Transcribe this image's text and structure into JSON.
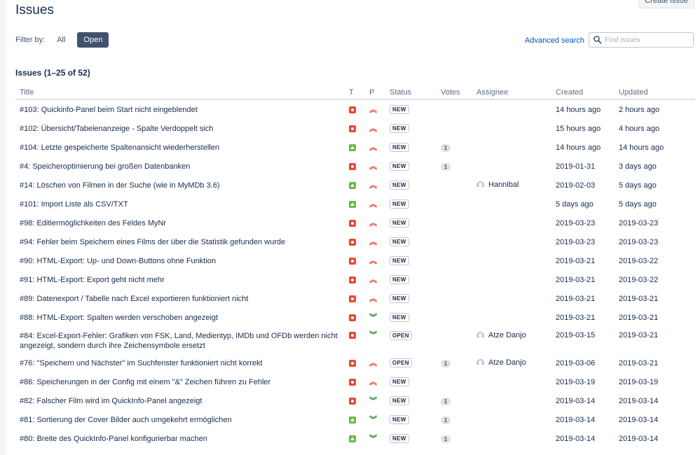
{
  "page": {
    "title": "Issues",
    "create_label": "Create issue",
    "filter_label": "Filter by:",
    "filters": [
      {
        "label": "All",
        "active": false
      },
      {
        "label": "Open",
        "active": true
      }
    ],
    "advanced_search": "Advanced search",
    "search_placeholder": "Find issues",
    "count": "Issues (1–25 of 52)"
  },
  "columns": [
    "Title",
    "T",
    "P",
    "Status",
    "Votes",
    "Assignee",
    "Created",
    "Updated"
  ],
  "issues": [
    {
      "title": "#103: Quickinfo-Panel beim Start nicht eingeblendet",
      "type": "bug",
      "priority": "major",
      "status": "NEW",
      "votes": "",
      "assignee": "",
      "created": "14 hours ago",
      "updated": "2 hours ago"
    },
    {
      "title": "#102: Übersicht/Tabelenanzeige - Spalte Verdoppelt sich",
      "type": "bug",
      "priority": "major",
      "status": "NEW",
      "votes": "",
      "assignee": "",
      "created": "15 hours ago",
      "updated": "4 hours ago"
    },
    {
      "title": "#104: Letzte gespeicherte Spaltenansicht wiederherstellen",
      "type": "enhancement",
      "priority": "major",
      "status": "NEW",
      "votes": "1",
      "assignee": "",
      "created": "14 hours ago",
      "updated": "14 hours ago"
    },
    {
      "title": "#4: Speicheroptimierung bei großen Datenbanken",
      "type": "bug",
      "priority": "major",
      "status": "NEW",
      "votes": "1",
      "assignee": "",
      "created": "2019-01-31",
      "updated": "3 days ago"
    },
    {
      "title": "#14: Löschen von Filmen in der Suche (wie in MyMDb 3.6)",
      "type": "enhancement",
      "priority": "major",
      "status": "NEW",
      "votes": "",
      "assignee": "Hannibal",
      "created": "2019-02-03",
      "updated": "5 days ago"
    },
    {
      "title": "#101: Import Liste als CSV/TXT",
      "type": "enhancement",
      "priority": "major",
      "status": "NEW",
      "votes": "",
      "assignee": "",
      "created": "5 days ago",
      "updated": "5 days ago"
    },
    {
      "title": "#98: Editiermöglichkeiten des Feldes MyNr",
      "type": "bug",
      "priority": "major",
      "status": "NEW",
      "votes": "",
      "assignee": "",
      "created": "2019-03-23",
      "updated": "2019-03-23"
    },
    {
      "title": "#94: Fehler beim Speichern eines Films der über die Statistik gefunden wurde",
      "type": "bug",
      "priority": "major",
      "status": "NEW",
      "votes": "",
      "assignee": "",
      "created": "2019-03-23",
      "updated": "2019-03-23"
    },
    {
      "title": "#90: HTML-Export: Up- und Down-Buttons ohne Funktion",
      "type": "bug",
      "priority": "major",
      "status": "NEW",
      "votes": "",
      "assignee": "",
      "created": "2019-03-21",
      "updated": "2019-03-22"
    },
    {
      "title": "#91: HTML-Export: Export geht nicht mehr",
      "type": "bug",
      "priority": "major",
      "status": "NEW",
      "votes": "",
      "assignee": "",
      "created": "2019-03-21",
      "updated": "2019-03-22"
    },
    {
      "title": "#89: Datenexport / Tabelle nach Excel exportieren funktioniert nicht",
      "type": "bug",
      "priority": "major",
      "status": "NEW",
      "votes": "",
      "assignee": "",
      "created": "2019-03-21",
      "updated": "2019-03-21"
    },
    {
      "title": "#88: HTML-Export: Spalten werden verschoben angezeigt",
      "type": "bug",
      "priority": "minor",
      "status": "NEW",
      "votes": "",
      "assignee": "",
      "created": "2019-03-21",
      "updated": "2019-03-21"
    },
    {
      "title": "#84: Excel-Export-Fehler: Grafiken von FSK, Land, Medientyp, IMDb und OFDb werden nicht angezeigt, sondern durch ihre Zeichensymbole ersetzt",
      "type": "bug",
      "priority": "minor",
      "status": "OPEN",
      "votes": "",
      "assignee": "Atze Danjo",
      "created": "2019-03-15",
      "updated": "2019-03-21",
      "tall": true
    },
    {
      "title": "#76: \"Speichern und Nächster\" im Suchfenster funktioniert nicht korrekt",
      "type": "bug",
      "priority": "major",
      "status": "OPEN",
      "votes": "1",
      "assignee": "Atze Danjo",
      "created": "2019-03-06",
      "updated": "2019-03-21"
    },
    {
      "title": "#86: Speicherungen in der Config mit einem \"&\" Zeichen führen zu Fehler",
      "type": "bug",
      "priority": "major",
      "status": "NEW",
      "votes": "",
      "assignee": "",
      "created": "2019-03-19",
      "updated": "2019-03-19"
    },
    {
      "title": "#82: Falscher Film wird im QuickInfo-Panel angezeigt",
      "type": "bug",
      "priority": "minor",
      "status": "NEW",
      "votes": "1",
      "assignee": "",
      "created": "2019-03-14",
      "updated": "2019-03-14"
    },
    {
      "title": "#81: Sortierung der Cover Bilder auch umgekehrt ermöglichen",
      "type": "enhancement",
      "priority": "minor",
      "status": "NEW",
      "votes": "1",
      "assignee": "",
      "created": "2019-03-14",
      "updated": "2019-03-14"
    },
    {
      "title": "#80: Breite des QuickInfo-Panel konfigurierbar machen",
      "type": "enhancement",
      "priority": "minor",
      "status": "NEW",
      "votes": "1",
      "assignee": "",
      "created": "2019-03-14",
      "updated": "2019-03-14"
    }
  ]
}
